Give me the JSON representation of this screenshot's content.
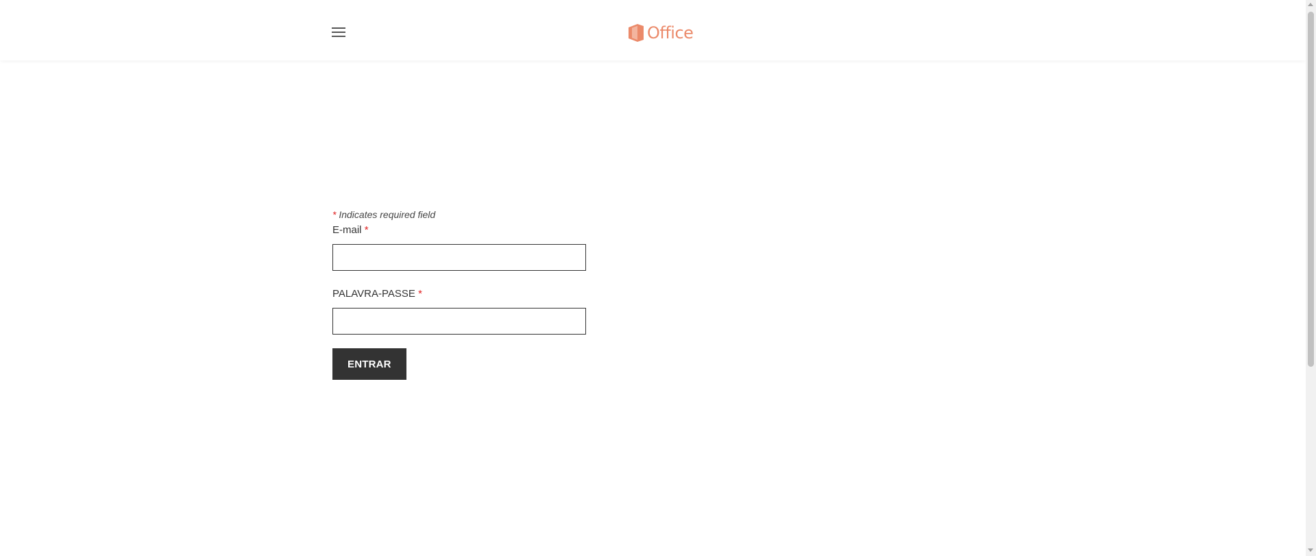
{
  "header": {
    "menu_icon": "hamburger-menu-icon",
    "logo": {
      "icon": "office-logo-icon",
      "text": "Office",
      "color": "#eb8a6a"
    }
  },
  "form": {
    "required_note_marker": "*",
    "required_note_text": " Indicates required field",
    "email": {
      "label": "E-mail",
      "required_marker": "*",
      "value": "",
      "placeholder": ""
    },
    "password": {
      "label": "PALAVRA-PASSE",
      "required_marker": "*",
      "value": "",
      "placeholder": ""
    },
    "submit_label": "ENTRAR"
  },
  "colors": {
    "accent": "#eb8a6a",
    "button_bg": "#333333",
    "required": "#e02020"
  }
}
